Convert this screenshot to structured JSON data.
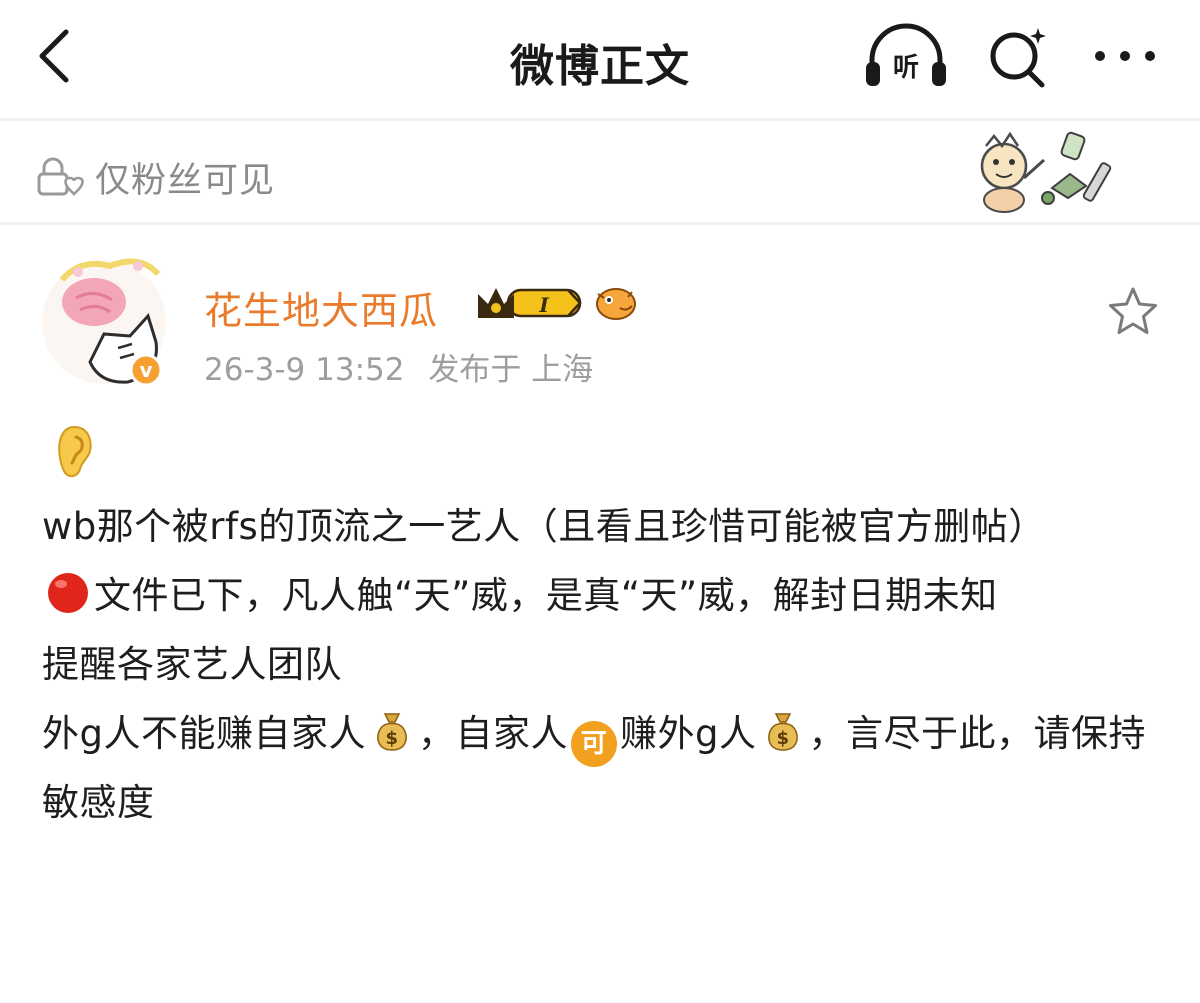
{
  "header": {
    "title": "微博正文",
    "listen_label": "听"
  },
  "visibility": {
    "label": "仅粉丝可见"
  },
  "post": {
    "author": "花生地大西瓜",
    "vip_level": "I",
    "verified_mark": "v",
    "timestamp": "26-3-9 13:52",
    "location": "发布于 上海",
    "lines": [
      [
        "wb那个被rfs的顶流之一艺人（且看且珍惜可能被官方删帖）"
      ],
      [
        "文件已下，凡人触“天”威，是真“天”威，解封日期未知"
      ],
      [
        "提醒各家艺人团队"
      ],
      [
        "外g人不能赚自家人",
        "，自家人",
        "可",
        "赚外g人",
        "，言尽于此，请保持敏感度"
      ]
    ]
  },
  "colors": {
    "accent": "#ea7b2c",
    "muted": "#9e9e9e",
    "red_dot": "#e0251b",
    "gold": "#f2b705"
  },
  "icons": {
    "back": "back-arrow-icon",
    "listen": "headphones-icon",
    "search": "search-icon",
    "more": "more-icon",
    "lock": "lock-icon",
    "favorite": "star-icon"
  }
}
